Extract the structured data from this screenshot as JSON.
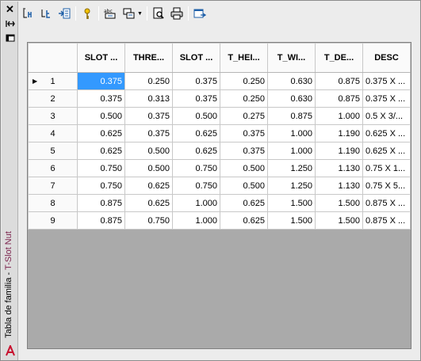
{
  "window": {
    "title_prefix": "Tabla de familia - ",
    "title_name": "T-Slot Nut"
  },
  "toolbar": {
    "buttons": [
      "add-parameter-icon",
      "add-user-parameter-icon",
      "create-properties-icon",
      "key-icon",
      "column-format-icon",
      "paste-icon",
      "verify-icon",
      "print-icon",
      "export-icon"
    ]
  },
  "table": {
    "columns": [
      "SLOT ...",
      "THRE...",
      "SLOT ...",
      "T_HEI...",
      "T_WI...",
      "T_DE...",
      "DESC"
    ],
    "rows": [
      {
        "num": "1",
        "cells": [
          "0.375",
          "0.250",
          "0.375",
          "0.250",
          "0.630",
          "0.875",
          "0.375 X ..."
        ]
      },
      {
        "num": "2",
        "cells": [
          "0.375",
          "0.313",
          "0.375",
          "0.250",
          "0.630",
          "0.875",
          "0.375 X ..."
        ]
      },
      {
        "num": "3",
        "cells": [
          "0.500",
          "0.375",
          "0.500",
          "0.275",
          "0.875",
          "1.000",
          "0.5 X 3/..."
        ]
      },
      {
        "num": "4",
        "cells": [
          "0.625",
          "0.375",
          "0.625",
          "0.375",
          "1.000",
          "1.190",
          "0.625 X ..."
        ]
      },
      {
        "num": "5",
        "cells": [
          "0.625",
          "0.500",
          "0.625",
          "0.375",
          "1.000",
          "1.190",
          "0.625 X ..."
        ]
      },
      {
        "num": "6",
        "cells": [
          "0.750",
          "0.500",
          "0.750",
          "0.500",
          "1.250",
          "1.130",
          "0.75 X 1..."
        ]
      },
      {
        "num": "7",
        "cells": [
          "0.750",
          "0.625",
          "0.750",
          "0.500",
          "1.250",
          "1.130",
          "0.75 X 5..."
        ]
      },
      {
        "num": "8",
        "cells": [
          "0.875",
          "0.625",
          "1.000",
          "0.625",
          "1.500",
          "1.500",
          "0.875 X ..."
        ]
      },
      {
        "num": "9",
        "cells": [
          "0.875",
          "0.750",
          "1.000",
          "0.625",
          "1.500",
          "1.500",
          "0.875 X ..."
        ]
      }
    ],
    "selected": {
      "row": 0,
      "col": 0
    },
    "selection_color": "#3399ff"
  }
}
